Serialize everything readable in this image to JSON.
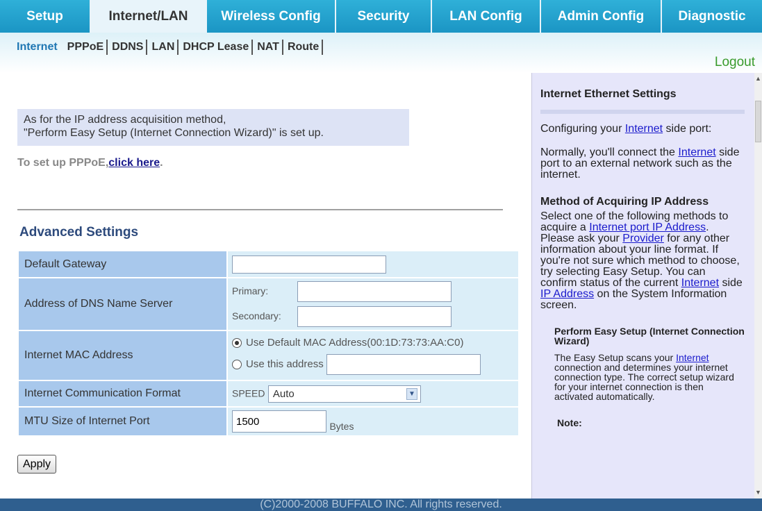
{
  "tabs": [
    {
      "label": "Setup"
    },
    {
      "label": "Internet/LAN",
      "active": true
    },
    {
      "label": "Wireless Config"
    },
    {
      "label": "Security"
    },
    {
      "label": "LAN Config"
    },
    {
      "label": "Admin Config"
    },
    {
      "label": "Diagnostic"
    }
  ],
  "subtabs": [
    "Internet",
    "PPPoE",
    "DDNS",
    "LAN",
    "DHCP Lease",
    "NAT",
    "Route"
  ],
  "logout": "Logout",
  "notice": {
    "line1": "As for the IP address acquisition method,",
    "line2": "\"Perform Easy Setup (Internet Connection Wizard)\" is set up."
  },
  "pppoe": {
    "prefix": "To set up PPPoE,",
    "link": "click here",
    "suffix": "."
  },
  "advanced": {
    "title": "Advanced Settings",
    "gateway_label": "Default Gateway",
    "gateway_value": "",
    "dns_label": "Address of DNS Name Server",
    "dns_primary_label": "Primary:",
    "dns_primary_value": "",
    "dns_secondary_label": "Secondary:",
    "dns_secondary_value": "",
    "mac_label": "Internet MAC Address",
    "mac_default_option": "Use Default MAC Address(00:1D:73:73:AA:C0)",
    "mac_custom_option": "Use this address",
    "mac_custom_value": "",
    "format_label": "Internet Communication Format",
    "speed_label": "SPEED",
    "speed_value": "Auto",
    "mtu_label": "MTU Size of Internet Port",
    "mtu_value": "1500",
    "mtu_unit": "Bytes"
  },
  "apply": "Apply",
  "help": {
    "title": "Internet Ethernet Settings",
    "p1_a": "Configuring your ",
    "p1_link": "Internet",
    "p1_b": " side port:",
    "p2_a": "Normally, you'll connect the ",
    "p2_link": "Internet",
    "p2_b": " side port to an external network such as the internet.",
    "method_title": "Method of Acquiring IP Address",
    "m_a": "Select one of the following methods to acquire a ",
    "m_link1": "Internet port IP Address",
    "m_b": ". Please ask your ",
    "m_link2": "Provider",
    "m_c": " for any other information about your line format. If you're not sure which method to choose, try selecting Easy Setup. You can confirm status of the current ",
    "m_link3": "Internet",
    "m_d": " side ",
    "m_link4": "IP Address",
    "m_e": " on the System Information screen.",
    "easy_title": "Perform Easy Setup (Internet Connection Wizard)",
    "e_a": "The Easy Setup scans your ",
    "e_link": "Internet",
    "e_b": " connection and determines your internet connection type. The correct setup wizard for your internet connection is then activated automatically.",
    "note": "Note:"
  },
  "footer": "(C)2000-2008 BUFFALO INC. All rights reserved."
}
